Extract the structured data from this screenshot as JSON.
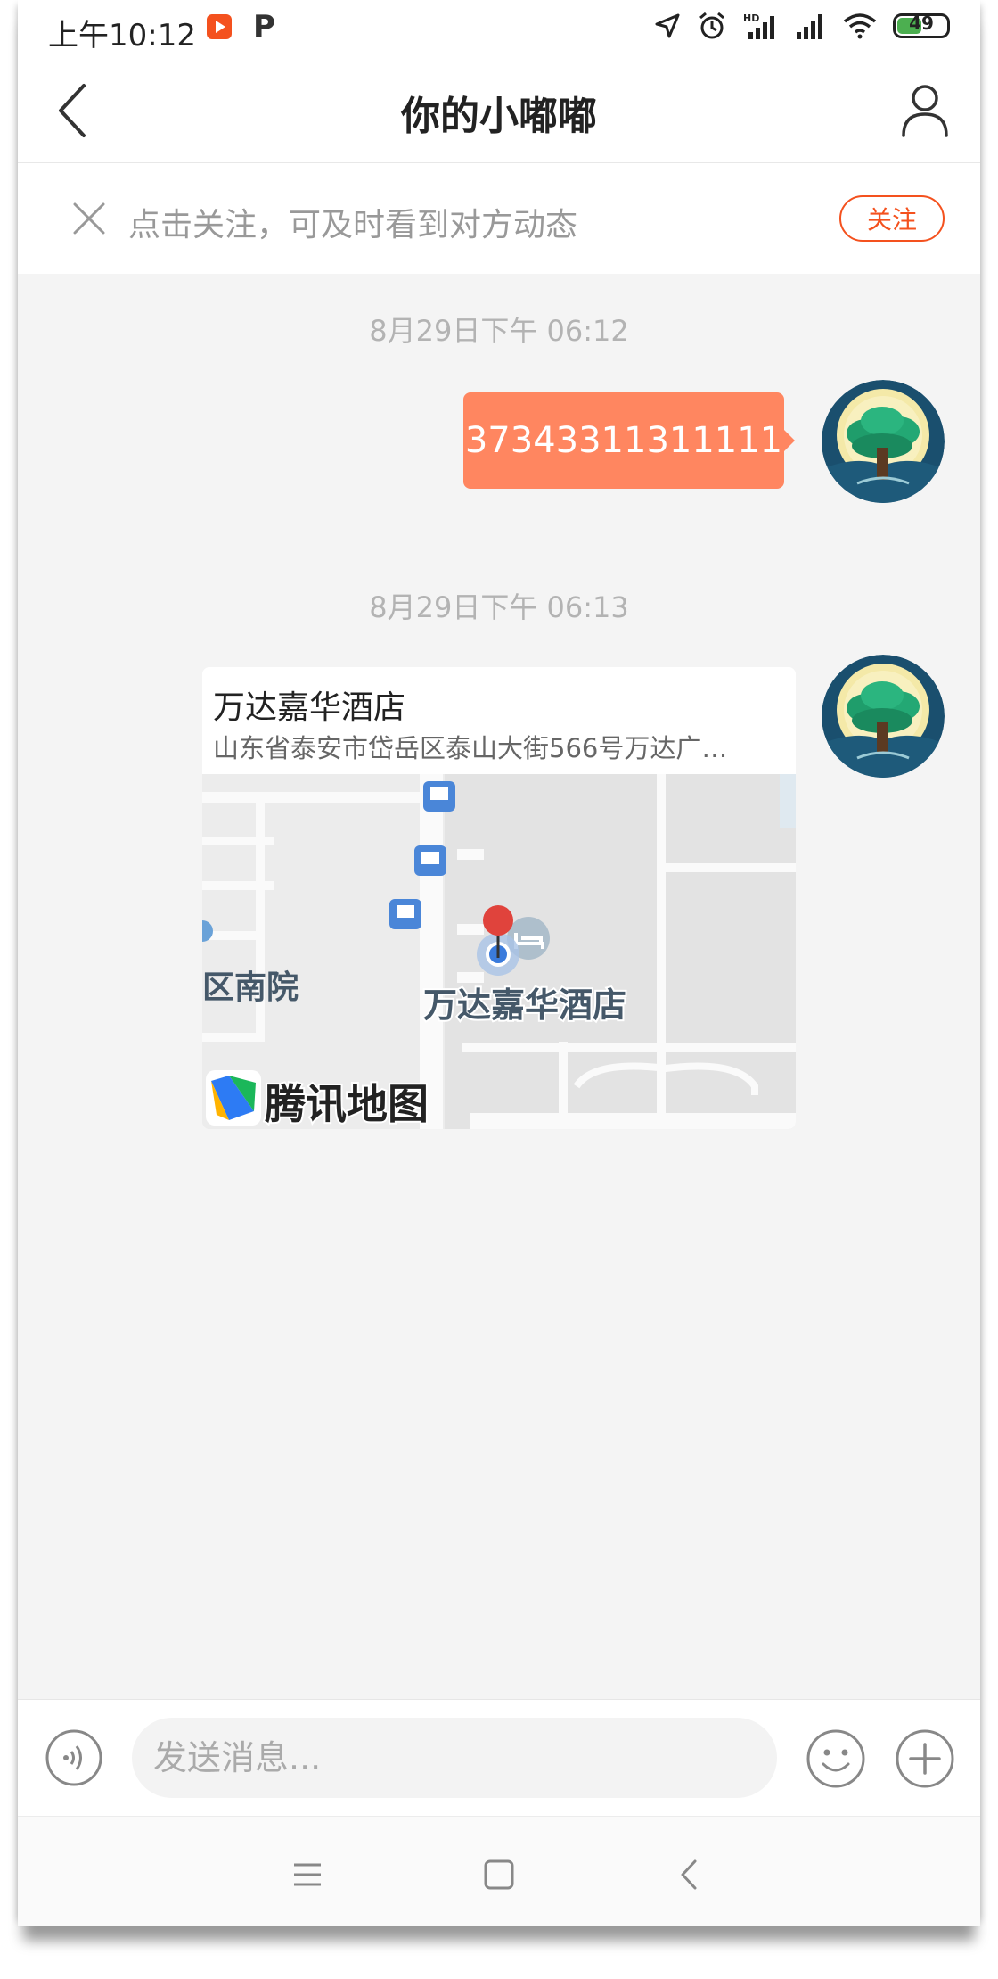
{
  "status_bar": {
    "time": "上午10:12",
    "battery_level": "49",
    "icons": [
      "video-app-icon",
      "p-app-icon",
      "location-arrow-icon",
      "alarm-icon",
      "hd-signal-icon",
      "signal-icon",
      "wifi-icon",
      "battery-icon"
    ]
  },
  "header": {
    "title": "你的小嘟嘟",
    "icons": [
      "back-arrow-icon",
      "person-icon"
    ]
  },
  "follow_banner": {
    "text": "点击关注，可及时看到对方动态",
    "button_label": "关注",
    "icons": [
      "close-icon"
    ]
  },
  "chat": {
    "messages": [
      {
        "timestamp": "8月29日下午 06:12",
        "type": "text",
        "text": "37343311311111"
      },
      {
        "timestamp": "8月29日下午 06:13",
        "type": "location",
        "place_name": "万达嘉华酒店",
        "address": "山东省泰安市岱岳区泰山大街566号万达广…",
        "map_labels": {
          "place": "万达嘉华酒店",
          "district": "区南院",
          "brand": "腾讯地图"
        }
      }
    ]
  },
  "input_bar": {
    "placeholder": "发送消息...",
    "icons": [
      "voice-icon",
      "emoji-icon",
      "plus-icon"
    ]
  },
  "nav_bar": {
    "icons": [
      "menu-icon",
      "home-icon",
      "back-icon"
    ]
  },
  "colors": {
    "accent": "#f4511e",
    "bubble": "#ff8660",
    "chat_background": "#f4f4f4",
    "timestamp_text": "#b3b3b3"
  }
}
